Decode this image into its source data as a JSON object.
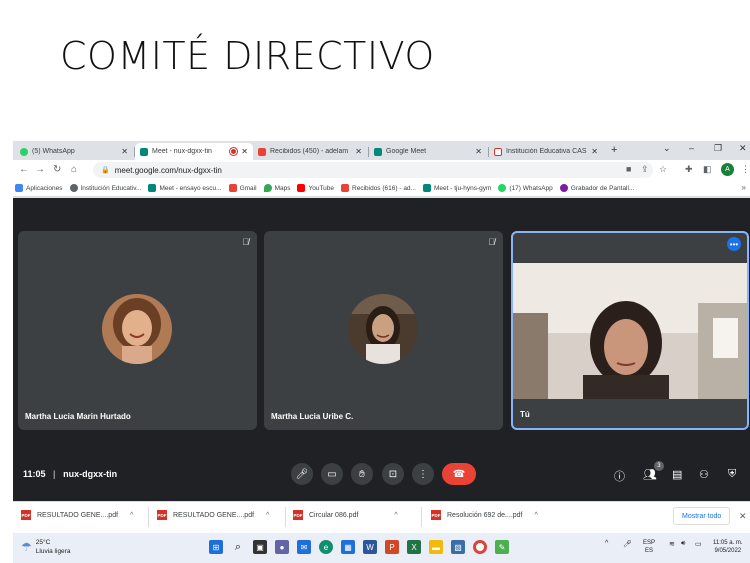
{
  "slide": {
    "title": "COMITÉ DIRECTIVO"
  },
  "browser": {
    "tabs": [
      {
        "label": "(5) WhatsApp",
        "color": "#25d366"
      },
      {
        "label": "Meet - nux-dgxx-tin",
        "color": "#00897b"
      },
      {
        "label": "Recibidos (450) - adelam",
        "color": "#ea4335"
      },
      {
        "label": "Google Meet",
        "color": "#00897b"
      },
      {
        "label": "Institución Educativa CAS",
        "color": "#d93025"
      }
    ],
    "url": "meet.google.com/nux-dgxx-tin",
    "profile_initial": "A",
    "bookmarks": [
      {
        "label": "Aplicaciones",
        "color": "#4285f4"
      },
      {
        "label": "Institución Educativ...",
        "color": "#5f6368"
      },
      {
        "label": "Meet - ensayo escu...",
        "color": "#00897b"
      },
      {
        "label": "Gmail",
        "color": "#ea4335"
      },
      {
        "label": "Maps",
        "color": "#34a853"
      },
      {
        "label": "YouTube",
        "color": "#ff0000"
      },
      {
        "label": "Recibidos (616) - ad...",
        "color": "#ea4335"
      },
      {
        "label": "Meet - tju-hyns-gym",
        "color": "#00897b"
      },
      {
        "label": "(17) WhatsApp",
        "color": "#25d366"
      },
      {
        "label": "Grabador de Pantall...",
        "color": "#7b1fa2"
      }
    ]
  },
  "meet": {
    "participants": [
      {
        "name": "Martha Lucia Marin Hurtado"
      },
      {
        "name": "Martha Lucia Uribe C."
      },
      {
        "name": "Tú"
      }
    ],
    "time": "11:05",
    "meeting_code": "nux-dgxx-tin",
    "people_count": "3"
  },
  "downloads": {
    "items": [
      {
        "label": "RESULTADO GENE....pdf"
      },
      {
        "label": "RESULTADO GENE....pdf"
      },
      {
        "label": "Circular 086.pdf"
      },
      {
        "label": "Resolución 692 de....pdf"
      }
    ],
    "show_all": "Mostrar todo",
    "icon_text": "PDF"
  },
  "taskbar": {
    "temperature": "25°C",
    "weather": "Lluvia ligera",
    "lang_top": "ESP",
    "lang_bottom": "ES",
    "time": "11:05 a. m.",
    "date": "9/05/2022"
  }
}
